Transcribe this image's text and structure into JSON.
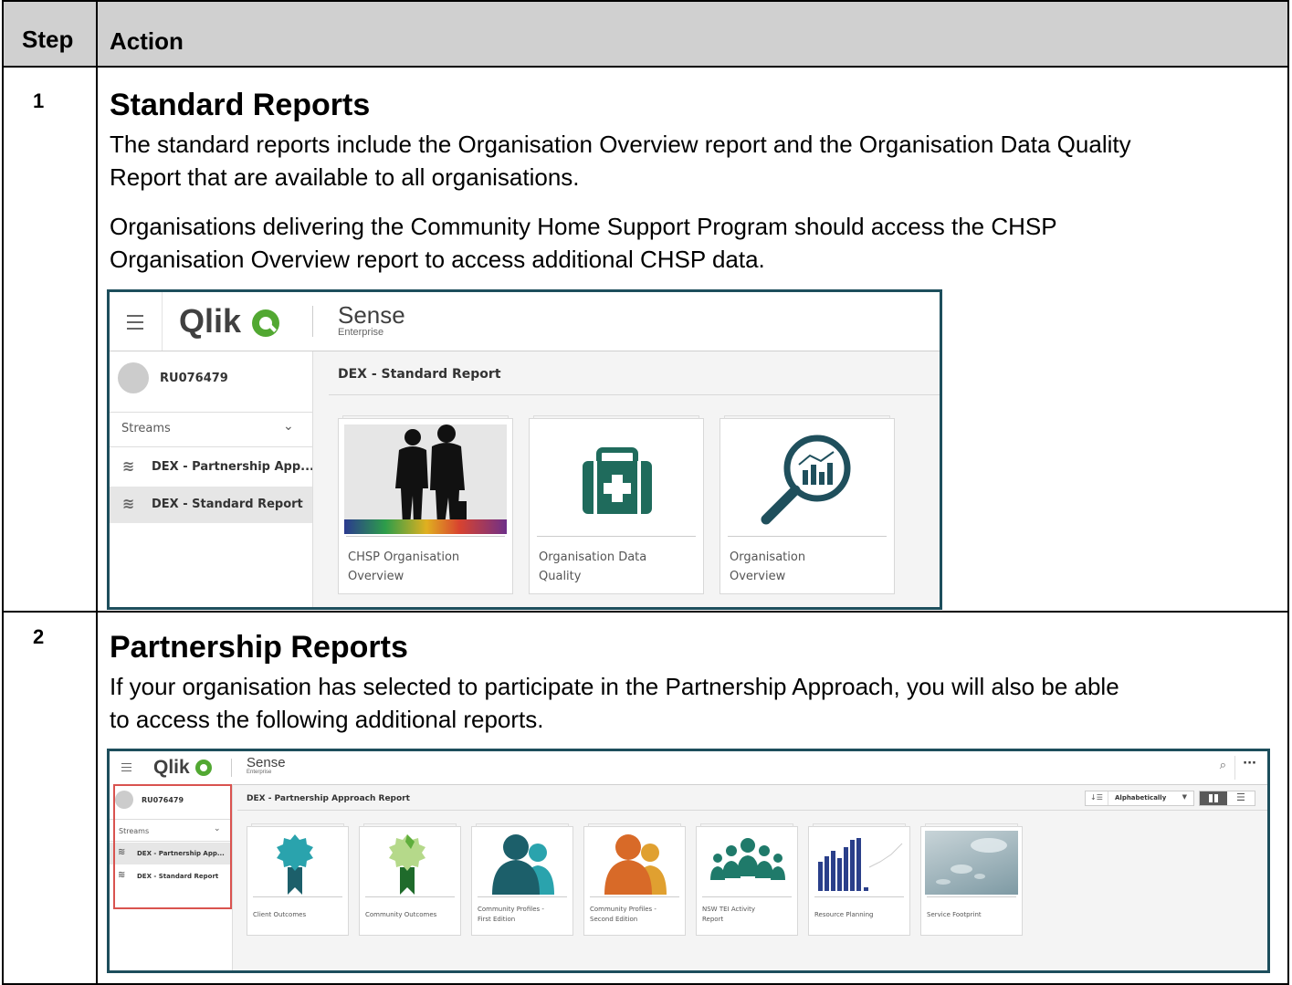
{
  "table": {
    "header": {
      "step": "Step",
      "action": "Action"
    },
    "rows": [
      {
        "step": "1",
        "title": "Standard Reports",
        "paragraphs": [
          "The standard reports include the Organisation Overview report and the Organisation Data Quality",
          "Report that are available to all organisations.",
          "Organisations delivering the Community Home Support Program should access the CHSP",
          "Organisation Overview report to access additional CHSP data."
        ]
      },
      {
        "step": "2",
        "title": "Partnership Reports",
        "paragraphs": [
          "If your organisation has selected to participate in the Partnership Approach, you will also be able",
          "to access the following additional reports."
        ]
      }
    ]
  },
  "screenshot1": {
    "logo": "Qlik",
    "product": "Sense",
    "edition": "Enterprise",
    "user": "RU076479",
    "streams_label": "Streams",
    "streams": [
      "DEX - Partnership App...",
      "DEX - Standard Report"
    ],
    "selected_stream_index": 1,
    "page_title": "DEX - Standard Report",
    "apps": [
      {
        "line1": "CHSP Organisation",
        "line2": "Overview",
        "thumb": "elderly-couple-silhouette"
      },
      {
        "line1": "Organisation Data",
        "line2": "Quality",
        "thumb": "first-aid-kit-icon"
      },
      {
        "line1": "Organisation",
        "line2": "Overview",
        "thumb": "magnifier-chart-icon"
      }
    ]
  },
  "screenshot2": {
    "logo": "Qlik",
    "product": "Sense",
    "edition": "Enterprise",
    "user": "RU076479",
    "streams_label": "Streams",
    "streams": [
      "DEX - Partnership App...",
      "DEX - Standard Report"
    ],
    "selected_stream_index": 0,
    "page_title": "DEX - Partnership Approach Report",
    "sort_label": "Alphabetically",
    "apps": [
      {
        "line1": "Client Outcomes",
        "line2": "",
        "thumb": "teal-award-ribbon"
      },
      {
        "line1": "Community Outcomes",
        "line2": "",
        "thumb": "green-award-ribbon"
      },
      {
        "line1": "Community Profiles -",
        "line2": "First Edition",
        "thumb": "teal-people-silhouettes"
      },
      {
        "line1": "Community Profiles -",
        "line2": "Second Edition",
        "thumb": "orange-people-silhouettes"
      },
      {
        "line1": "NSW TEI Activity",
        "line2": "Report",
        "thumb": "teal-group-icon"
      },
      {
        "line1": "Resource Planning",
        "line2": "",
        "thumb": "blue-bar-chart"
      },
      {
        "line1": "Service Footprint",
        "line2": "",
        "thumb": "water-drops-photo"
      }
    ]
  }
}
